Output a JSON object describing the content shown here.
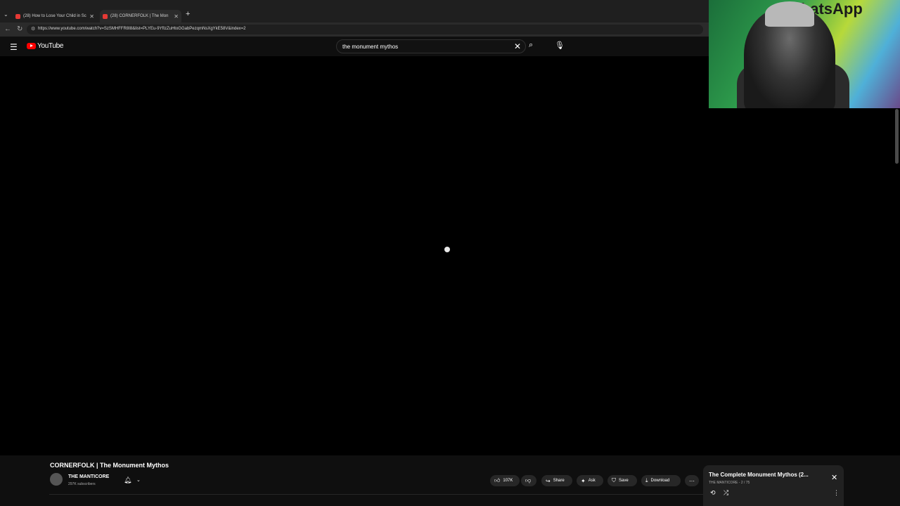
{
  "browser": {
    "tabs": [
      {
        "label": "(28) How to Lose Your Child in Sc"
      },
      {
        "label": "(28) CORNERFOLK | The Mon"
      }
    ],
    "url": "https://www.youtube.com/watch?v=SzSMHFFR8I8&list=PLYEu-9YfIzZuHtoGGabPezqmNsXgYkE58V&index=2"
  },
  "youtube": {
    "logo_text": "YouTube",
    "search_query": "the monument mythos"
  },
  "video": {
    "title": "CORNERFOLK | The Monument Mythos",
    "channel": "THE MANTICORE",
    "subscribers": "297K subscribers"
  },
  "actions": {
    "like_count": "107K",
    "share": "Share",
    "ask": "Ask",
    "save": "Save",
    "download": "Download"
  },
  "playlist": {
    "title": "The Complete Monument Mythos (2...",
    "subtitle": "THE MANTICORE - 2 / 75"
  },
  "webcam": {
    "sign_text": "WhatsApp"
  },
  "colors": {
    "brand_red": "#ff0000",
    "page_bg": "#0f0f0f"
  }
}
